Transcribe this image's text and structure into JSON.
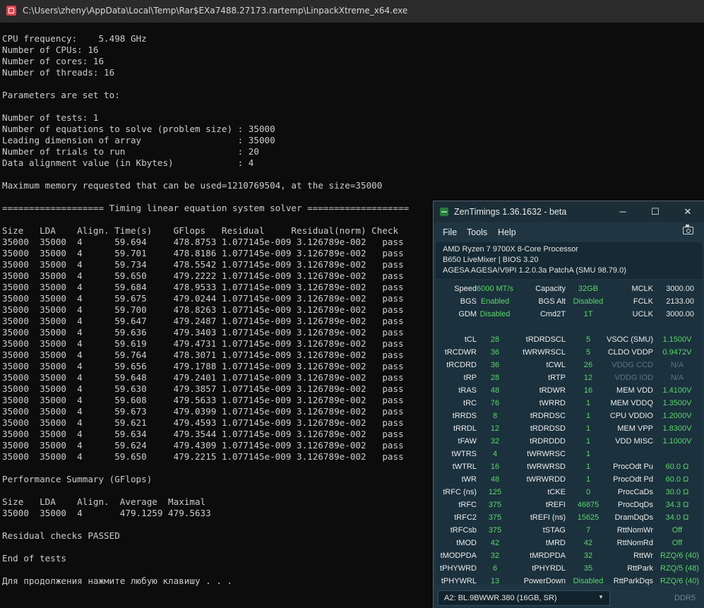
{
  "console": {
    "title": "C:\\Users\\zheny\\AppData\\Local\\Temp\\Rar$EXa7488.27173.rartemp\\LinpackXtreme_x64.exe",
    "lines": [
      "CPU frequency:    5.498 GHz",
      "Number of CPUs: 16",
      "Number of cores: 16",
      "Number of threads: 16",
      "",
      "Parameters are set to:",
      "",
      "Number of tests: 1",
      "Number of equations to solve (problem size) : 35000",
      "Leading dimension of array                  : 35000",
      "Number of trials to run                     : 20",
      "Data alignment value (in Kbytes)            : 4",
      "",
      "Maximum memory requested that can be used=1210769504, at the size=35000",
      "",
      "=================== Timing linear equation system solver ===================",
      "",
      "Size   LDA    Align. Time(s)    GFlops   Residual     Residual(norm) Check",
      "35000  35000  4      59.694     478.8753 1.077145e-009 3.126789e-002   pass",
      "35000  35000  4      59.701     478.8186 1.077145e-009 3.126789e-002   pass",
      "35000  35000  4      59.734     478.5542 1.077145e-009 3.126789e-002   pass",
      "35000  35000  4      59.650     479.2222 1.077145e-009 3.126789e-002   pass",
      "35000  35000  4      59.684     478.9533 1.077145e-009 3.126789e-002   pass",
      "35000  35000  4      59.675     479.0244 1.077145e-009 3.126789e-002   pass",
      "35000  35000  4      59.700     478.8263 1.077145e-009 3.126789e-002   pass",
      "35000  35000  4      59.647     479.2487 1.077145e-009 3.126789e-002   pass",
      "35000  35000  4      59.636     479.3403 1.077145e-009 3.126789e-002   pass",
      "35000  35000  4      59.619     479.4731 1.077145e-009 3.126789e-002   pass",
      "35000  35000  4      59.764     478.3071 1.077145e-009 3.126789e-002   pass",
      "35000  35000  4      59.656     479.1788 1.077145e-009 3.126789e-002   pass",
      "35000  35000  4      59.648     479.2401 1.077145e-009 3.126789e-002   pass",
      "35000  35000  4      59.630     479.3857 1.077145e-009 3.126789e-002   pass",
      "35000  35000  4      59.608     479.5633 1.077145e-009 3.126789e-002   pass",
      "35000  35000  4      59.673     479.0399 1.077145e-009 3.126789e-002   pass",
      "35000  35000  4      59.621     479.4593 1.077145e-009 3.126789e-002   pass",
      "35000  35000  4      59.634     479.3544 1.077145e-009 3.126789e-002   pass",
      "35000  35000  4      59.624     479.4309 1.077145e-009 3.126789e-002   pass",
      "35000  35000  4      59.650     479.2215 1.077145e-009 3.126789e-002   pass",
      "",
      "Performance Summary (GFlops)",
      "",
      "Size   LDA    Align.  Average  Maximal",
      "35000  35000  4       479.1259 479.5633",
      "",
      "Residual checks PASSED",
      "",
      "End of tests",
      "",
      "Для продолжения нажмите любую клавишу . . ."
    ]
  },
  "zentimings": {
    "title": "ZenTimings 1.36.1632 - beta",
    "window_controls": {
      "minimize": "─",
      "maximize": "☐",
      "close": "✕"
    },
    "menu": [
      "File",
      "Tools",
      "Help"
    ],
    "info": [
      "AMD Ryzen 7 9700X 8-Core Processor",
      "B650 LiveMixer | BIOS 3.20",
      "AGESA AGESA!V9PI 1.2.0.3a PatchA (SMU 98.79.0)"
    ],
    "rows": [
      [
        [
          "Speed",
          "6000 MT/s"
        ],
        [
          "Capacity",
          "32GB"
        ],
        [
          "MCLK",
          "3000.00"
        ]
      ],
      [
        [
          "BGS",
          "Enabled"
        ],
        [
          "BGS Alt",
          "Disabled"
        ],
        [
          "FCLK",
          "2133.00"
        ]
      ],
      [
        [
          "GDM",
          "Disabled"
        ],
        [
          "Cmd2T",
          "1T"
        ],
        [
          "UCLK",
          "3000.00"
        ]
      ],
      null,
      [
        [
          "tCL",
          "28"
        ],
        [
          "tRDRDSCL",
          "5"
        ],
        [
          "VSOC (SMU)",
          "1.1500V"
        ]
      ],
      [
        [
          "tRCDWR",
          "36"
        ],
        [
          "tWRWRSCL",
          "5"
        ],
        [
          "CLDO VDDP",
          "0.9472V"
        ]
      ],
      [
        [
          "tRCDRD",
          "36"
        ],
        [
          "tCWL",
          "26"
        ],
        [
          "VDDG CCD",
          "N/A"
        ]
      ],
      [
        [
          "tRP",
          "28"
        ],
        [
          "tRTP",
          "12"
        ],
        [
          "VDDG IOD",
          "N/A"
        ]
      ],
      [
        [
          "tRAS",
          "48"
        ],
        [
          "tRDWR",
          "16"
        ],
        [
          "MEM VDD",
          "1.4100V"
        ]
      ],
      [
        [
          "tRC",
          "76"
        ],
        [
          "tWRRD",
          "1"
        ],
        [
          "MEM VDDQ",
          "1.3500V"
        ]
      ],
      [
        [
          "tRRDS",
          "8"
        ],
        [
          "tRDRDSC",
          "1"
        ],
        [
          "CPU VDDIO",
          "1.2000V"
        ]
      ],
      [
        [
          "tRRDL",
          "12"
        ],
        [
          "tRDRDSD",
          "1"
        ],
        [
          "MEM VPP",
          "1.8300V"
        ]
      ],
      [
        [
          "tFAW",
          "32"
        ],
        [
          "tRDRDDD",
          "1"
        ],
        [
          "VDD MISC",
          "1.1000V"
        ]
      ],
      [
        [
          "tWTRS",
          "4"
        ],
        [
          "tWRWRSC",
          "1"
        ],
        [
          "",
          ""
        ]
      ],
      [
        [
          "tWTRL",
          "16"
        ],
        [
          "tWRWRSD",
          "1"
        ],
        [
          "ProcOdt Pu",
          "60.0 Ω"
        ]
      ],
      [
        [
          "tWR",
          "48"
        ],
        [
          "tWRWRDD",
          "1"
        ],
        [
          "ProcOdt Pd",
          "60.0 Ω"
        ]
      ],
      [
        [
          "tRFC (ns)",
          "125"
        ],
        [
          "tCKE",
          "0"
        ],
        [
          "ProcCaDs",
          "30.0 Ω"
        ]
      ],
      [
        [
          "tRFC",
          "375"
        ],
        [
          "tREFI",
          "46875"
        ],
        [
          "ProcDqDs",
          "34.3 Ω"
        ]
      ],
      [
        [
          "tRFC2",
          "375"
        ],
        [
          "tREFI (ns)",
          "15625"
        ],
        [
          "DramDqDs",
          "34.0 Ω"
        ]
      ],
      [
        [
          "tRFCsb",
          "375"
        ],
        [
          "tSTAG",
          "7"
        ],
        [
          "RttNomWr",
          "Off"
        ]
      ],
      [
        [
          "tMOD",
          "42"
        ],
        [
          "tMRD",
          "42"
        ],
        [
          "RttNomRd",
          "Off"
        ]
      ],
      [
        [
          "tMODPDA",
          "32"
        ],
        [
          "tMRDPDA",
          "32"
        ],
        [
          "RttWr",
          "RZQ/6 (40)"
        ]
      ],
      [
        [
          "tPHYWRD",
          "6"
        ],
        [
          "tPHYRDL",
          "35"
        ],
        [
          "RttPark",
          "RZQ/5 (48)"
        ]
      ],
      [
        [
          "tPHYWRL",
          "13"
        ],
        [
          "PowerDown",
          "Disabled"
        ],
        [
          "RttParkDqs",
          "RZQ/6 (40)"
        ]
      ]
    ],
    "dimm_selected": "A2: BL.9BWWR.380 (16GB, SR)",
    "mem_type": "DDR5",
    "colors": {
      "value": "#5bd66b",
      "clock": "#e6e6e6",
      "dim": "#5f7480",
      "bg": "#1f3642"
    }
  }
}
